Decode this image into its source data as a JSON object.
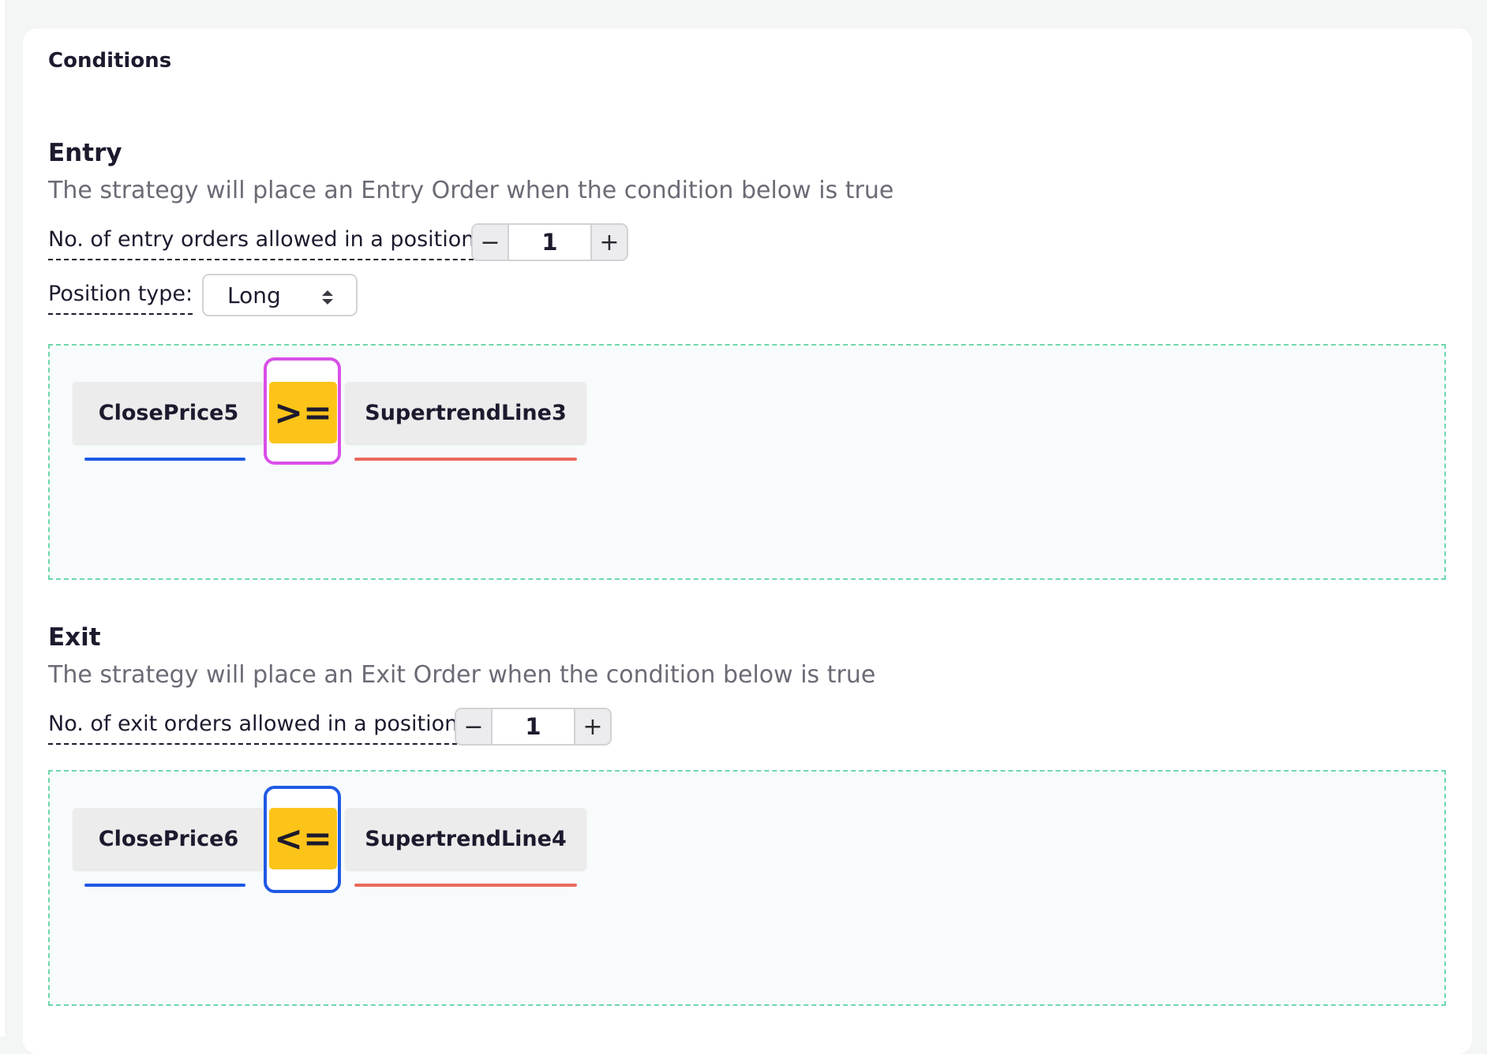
{
  "card": {
    "title": "Conditions"
  },
  "entry": {
    "title": "Entry",
    "description": "The strategy will place an Entry Order when the condition below is true",
    "orders_label": "No. of entry orders allowed in a position:",
    "orders_value": "1",
    "position_type_label": "Position type:",
    "position_type_value": "Long",
    "condition": {
      "left_operand": "ClosePrice5",
      "operator": ">=",
      "right_operand": "SupertrendLine3",
      "operator_outline_color": "#d94fe8"
    }
  },
  "exit": {
    "title": "Exit",
    "description": "The strategy will place an Exit Order when the condition below is true",
    "orders_label": "No. of exit orders allowed in a position:",
    "orders_value": "1",
    "condition": {
      "left_operand": "ClosePrice6",
      "operator": "<=",
      "right_operand": "SupertrendLine4",
      "operator_outline_color": "#1f5ae6"
    }
  },
  "stepper": {
    "minus_symbol": "−",
    "plus_symbol": "+"
  },
  "colors": {
    "left_operand_line": "#1f5ae6",
    "right_operand_line": "#ea6a5c",
    "operator_fill": "#fcc419",
    "condition_border": "#6ed7ac"
  },
  "icons": {
    "select_arrows": "sort-updown-icon",
    "minus": "minus-icon",
    "plus": "plus-icon"
  }
}
